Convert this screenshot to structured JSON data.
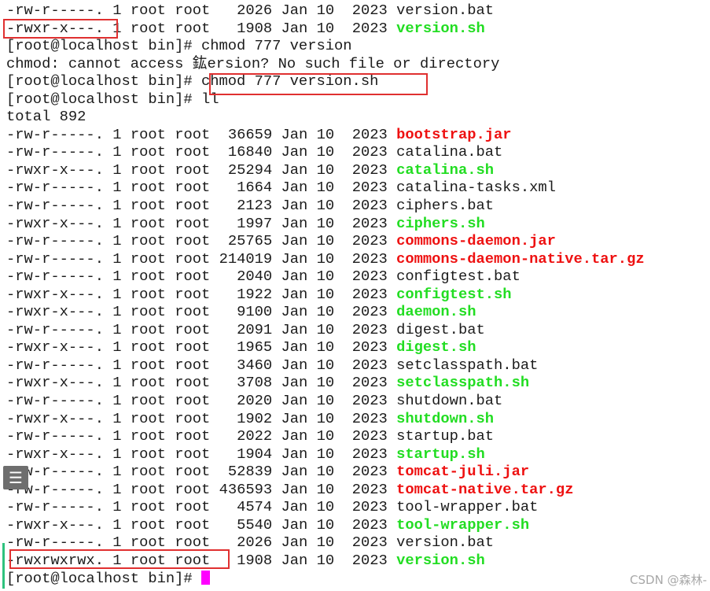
{
  "terminal": {
    "lines": [
      {
        "type": "file",
        "perm": "-rw-r-----.",
        "links": "1",
        "owner": "root",
        "group": "root",
        "size": "2026",
        "month": "Jan",
        "day": "10",
        "year": "2023",
        "name": "version.bat",
        "style": "plain"
      },
      {
        "type": "file",
        "perm": "-rwxr-x---.",
        "links": "1",
        "owner": "root",
        "group": "root",
        "size": "1908",
        "month": "Jan",
        "day": "10",
        "year": "2023",
        "name": "version.sh",
        "style": "exe"
      },
      {
        "type": "text",
        "text": "[root@localhost bin]# chmod 777 version"
      },
      {
        "type": "text",
        "text": "chmod: cannot access 鈜ersion? No such file or directory"
      },
      {
        "type": "text",
        "text": "[root@localhost bin]# chmod 777 version.sh"
      },
      {
        "type": "text",
        "text": "[root@localhost bin]# ll"
      },
      {
        "type": "text",
        "text": "total 892"
      },
      {
        "type": "file",
        "perm": "-rw-r-----.",
        "links": "1",
        "owner": "root",
        "group": "root",
        "size": "36659",
        "month": "Jan",
        "day": "10",
        "year": "2023",
        "name": "bootstrap.jar",
        "style": "arc"
      },
      {
        "type": "file",
        "perm": "-rw-r-----.",
        "links": "1",
        "owner": "root",
        "group": "root",
        "size": "16840",
        "month": "Jan",
        "day": "10",
        "year": "2023",
        "name": "catalina.bat",
        "style": "plain"
      },
      {
        "type": "file",
        "perm": "-rwxr-x---.",
        "links": "1",
        "owner": "root",
        "group": "root",
        "size": "25294",
        "month": "Jan",
        "day": "10",
        "year": "2023",
        "name": "catalina.sh",
        "style": "exe"
      },
      {
        "type": "file",
        "perm": "-rw-r-----.",
        "links": "1",
        "owner": "root",
        "group": "root",
        "size": "1664",
        "month": "Jan",
        "day": "10",
        "year": "2023",
        "name": "catalina-tasks.xml",
        "style": "plain"
      },
      {
        "type": "file",
        "perm": "-rw-r-----.",
        "links": "1",
        "owner": "root",
        "group": "root",
        "size": "2123",
        "month": "Jan",
        "day": "10",
        "year": "2023",
        "name": "ciphers.bat",
        "style": "plain"
      },
      {
        "type": "file",
        "perm": "-rwxr-x---.",
        "links": "1",
        "owner": "root",
        "group": "root",
        "size": "1997",
        "month": "Jan",
        "day": "10",
        "year": "2023",
        "name": "ciphers.sh",
        "style": "exe"
      },
      {
        "type": "file",
        "perm": "-rw-r-----.",
        "links": "1",
        "owner": "root",
        "group": "root",
        "size": "25765",
        "month": "Jan",
        "day": "10",
        "year": "2023",
        "name": "commons-daemon.jar",
        "style": "arc"
      },
      {
        "type": "file",
        "perm": "-rw-r-----.",
        "links": "1",
        "owner": "root",
        "group": "root",
        "size": "214019",
        "month": "Jan",
        "day": "10",
        "year": "2023",
        "name": "commons-daemon-native.tar.gz",
        "style": "arc"
      },
      {
        "type": "file",
        "perm": "-rw-r-----.",
        "links": "1",
        "owner": "root",
        "group": "root",
        "size": "2040",
        "month": "Jan",
        "day": "10",
        "year": "2023",
        "name": "configtest.bat",
        "style": "plain"
      },
      {
        "type": "file",
        "perm": "-rwxr-x---.",
        "links": "1",
        "owner": "root",
        "group": "root",
        "size": "1922",
        "month": "Jan",
        "day": "10",
        "year": "2023",
        "name": "configtest.sh",
        "style": "exe"
      },
      {
        "type": "file",
        "perm": "-rwxr-x---.",
        "links": "1",
        "owner": "root",
        "group": "root",
        "size": "9100",
        "month": "Jan",
        "day": "10",
        "year": "2023",
        "name": "daemon.sh",
        "style": "exe"
      },
      {
        "type": "file",
        "perm": "-rw-r-----.",
        "links": "1",
        "owner": "root",
        "group": "root",
        "size": "2091",
        "month": "Jan",
        "day": "10",
        "year": "2023",
        "name": "digest.bat",
        "style": "plain"
      },
      {
        "type": "file",
        "perm": "-rwxr-x---.",
        "links": "1",
        "owner": "root",
        "group": "root",
        "size": "1965",
        "month": "Jan",
        "day": "10",
        "year": "2023",
        "name": "digest.sh",
        "style": "exe"
      },
      {
        "type": "file",
        "perm": "-rw-r-----.",
        "links": "1",
        "owner": "root",
        "group": "root",
        "size": "3460",
        "month": "Jan",
        "day": "10",
        "year": "2023",
        "name": "setclasspath.bat",
        "style": "plain"
      },
      {
        "type": "file",
        "perm": "-rwxr-x---.",
        "links": "1",
        "owner": "root",
        "group": "root",
        "size": "3708",
        "month": "Jan",
        "day": "10",
        "year": "2023",
        "name": "setclasspath.sh",
        "style": "exe"
      },
      {
        "type": "file",
        "perm": "-rw-r-----.",
        "links": "1",
        "owner": "root",
        "group": "root",
        "size": "2020",
        "month": "Jan",
        "day": "10",
        "year": "2023",
        "name": "shutdown.bat",
        "style": "plain"
      },
      {
        "type": "file",
        "perm": "-rwxr-x---.",
        "links": "1",
        "owner": "root",
        "group": "root",
        "size": "1902",
        "month": "Jan",
        "day": "10",
        "year": "2023",
        "name": "shutdown.sh",
        "style": "exe"
      },
      {
        "type": "file",
        "perm": "-rw-r-----.",
        "links": "1",
        "owner": "root",
        "group": "root",
        "size": "2022",
        "month": "Jan",
        "day": "10",
        "year": "2023",
        "name": "startup.bat",
        "style": "plain"
      },
      {
        "type": "file",
        "perm": "-rwxr-x---.",
        "links": "1",
        "owner": "root",
        "group": "root",
        "size": "1904",
        "month": "Jan",
        "day": "10",
        "year": "2023",
        "name": "startup.sh",
        "style": "exe"
      },
      {
        "type": "file",
        "perm": "-rw-r-----.",
        "links": "1",
        "owner": "root",
        "group": "root",
        "size": "52839",
        "month": "Jan",
        "day": "10",
        "year": "2023",
        "name": "tomcat-juli.jar",
        "style": "arc"
      },
      {
        "type": "file",
        "perm": "-rw-r-----.",
        "links": "1",
        "owner": "root",
        "group": "root",
        "size": "436593",
        "month": "Jan",
        "day": "10",
        "year": "2023",
        "name": "tomcat-native.tar.gz",
        "style": "arc"
      },
      {
        "type": "file",
        "perm": "-rw-r-----.",
        "links": "1",
        "owner": "root",
        "group": "root",
        "size": "4574",
        "month": "Jan",
        "day": "10",
        "year": "2023",
        "name": "tool-wrapper.bat",
        "style": "plain"
      },
      {
        "type": "file",
        "perm": "-rwxr-x---.",
        "links": "1",
        "owner": "root",
        "group": "root",
        "size": "5540",
        "month": "Jan",
        "day": "10",
        "year": "2023",
        "name": "tool-wrapper.sh",
        "style": "exe"
      },
      {
        "type": "file",
        "perm": "-rw-r-----.",
        "links": "1",
        "owner": "root",
        "group": "root",
        "size": "2026",
        "month": "Jan",
        "day": "10",
        "year": "2023",
        "name": "version.bat",
        "style": "plain"
      },
      {
        "type": "file",
        "perm": "-rwxrwxrwx.",
        "links": "1",
        "owner": "root",
        "group": "root",
        "size": "1908",
        "month": "Jan",
        "day": "10",
        "year": "2023",
        "name": "version.sh",
        "style": "exe"
      },
      {
        "type": "prompt",
        "text": "[root@localhost bin]# "
      }
    ]
  },
  "overlay": {
    "menu_icon": "menu-icon",
    "menu_glyph": "☰"
  },
  "watermark": "CSDN @森林-",
  "colors": {
    "executable": "#22dd22",
    "archive": "#ee1111",
    "highlight_box": "#e03030",
    "cursor": "#ff00ff",
    "text": "#1b1b1b"
  }
}
